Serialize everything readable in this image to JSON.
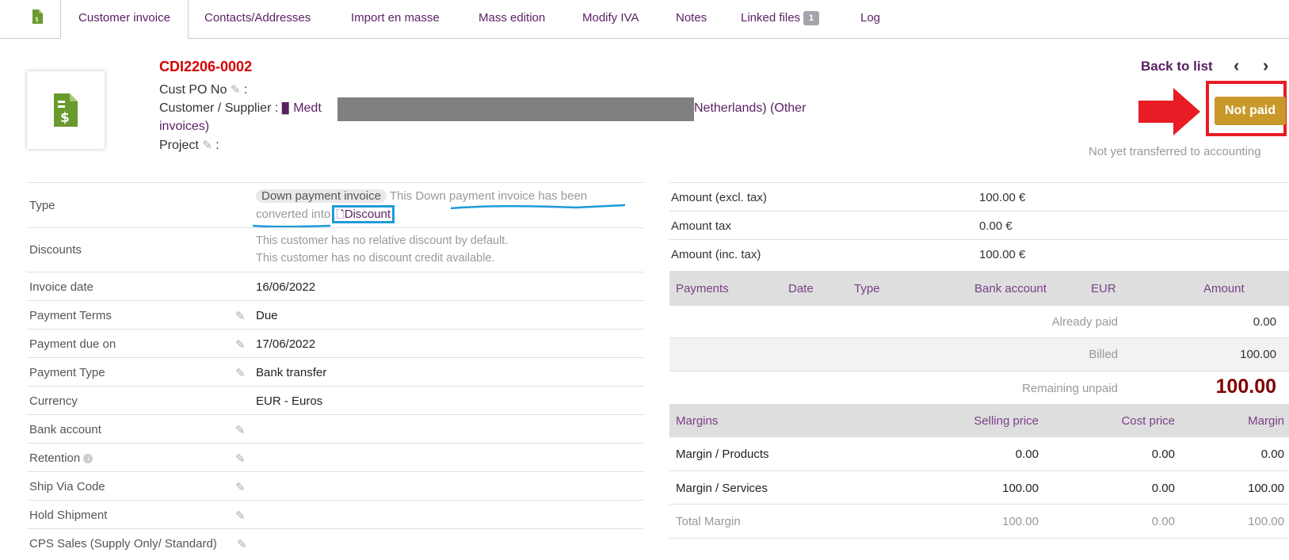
{
  "tabs": [
    {
      "label": "Customer invoice",
      "active": true
    },
    {
      "label": "Contacts/Addresses"
    },
    {
      "label": "Import en masse"
    },
    {
      "label": "Mass edition"
    },
    {
      "label": "Modify IVA"
    },
    {
      "label": "Notes"
    },
    {
      "label": "Linked files",
      "badge": "1"
    },
    {
      "label": "Log"
    }
  ],
  "header": {
    "ref": "CDI2206-0002",
    "cust_po_label": "Cust PO No",
    "customer_label": "Customer / Supplier :",
    "customer_prefix": "Medt",
    "customer_suffix": "Netherlands) (Other",
    "customer_suffix2": "invoices)",
    "project_label": "Project",
    "back_to_list": "Back to list",
    "status": "Not paid",
    "accounting_note": "Not yet transferred to accounting",
    "colors": {
      "ref": "#d60000",
      "status": "#c8982b",
      "link": "#5a1f63",
      "highlight": "#e81c24"
    }
  },
  "fields": {
    "type_label": "Type",
    "type_tag": "Down payment invoice",
    "type_note1": "This Down payment invoice has been",
    "type_note2": "converted into",
    "type_link": "Discount",
    "discounts_label": "Discounts",
    "discounts_line1": "This customer has no relative discount by default.",
    "discounts_line2": "This customer has no discount credit available.",
    "rows": [
      {
        "label": "Invoice date",
        "value": "16/06/2022",
        "editable": false
      },
      {
        "label": "Payment Terms",
        "value": "Due",
        "editable": true
      },
      {
        "label": "Payment due on",
        "value": "17/06/2022",
        "editable": true
      },
      {
        "label": "Payment Type",
        "value": "Bank transfer",
        "editable": true
      },
      {
        "label": "Currency",
        "value": "EUR - Euros",
        "editable": false
      },
      {
        "label": "Bank account",
        "value": "",
        "editable": true
      },
      {
        "label": "Retention",
        "value": "",
        "editable": true
      },
      {
        "label": "Ship Via Code",
        "value": "",
        "editable": true
      },
      {
        "label": "Hold Shipment",
        "value": "",
        "editable": true
      },
      {
        "label": "CPS Sales (Supply Only/ Standard)",
        "value": "",
        "editable": true
      }
    ]
  },
  "amounts": {
    "excl_label": "Amount (excl. tax)",
    "excl_value": "100.00 €",
    "tax_label": "Amount tax",
    "tax_value": "0.00 €",
    "inc_label": "Amount (inc. tax)",
    "inc_value": "100.00 €"
  },
  "payments": {
    "headers": [
      "Payments",
      "Date",
      "Type",
      "Bank account",
      "EUR",
      "Amount"
    ],
    "already_paid_label": "Already paid",
    "already_paid_value": "0.00",
    "billed_label": "Billed",
    "billed_value": "100.00",
    "remaining_label": "Remaining unpaid",
    "remaining_value": "100.00"
  },
  "margins": {
    "headers": [
      "Margins",
      "Selling price",
      "Cost price",
      "Margin"
    ],
    "rows": [
      {
        "label": "Margin / Products",
        "selling": "0.00",
        "cost": "0.00",
        "margin": "0.00"
      },
      {
        "label": "Margin / Services",
        "selling": "100.00",
        "cost": "0.00",
        "margin": "100.00"
      },
      {
        "label": "Total Margin",
        "selling": "100.00",
        "cost": "0.00",
        "margin": "100.00"
      }
    ]
  }
}
